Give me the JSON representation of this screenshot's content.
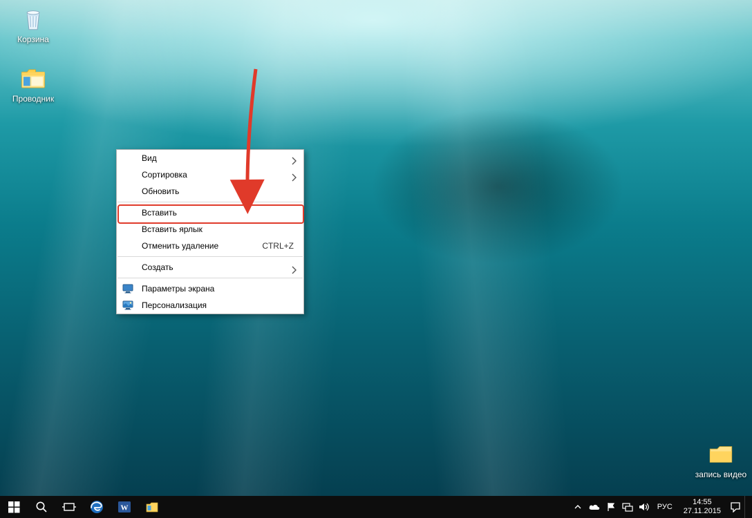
{
  "desktop": {
    "icons": {
      "recycle_bin": "Корзина",
      "file_explorer": "Проводник",
      "video_folder": "запись видео"
    }
  },
  "context_menu": {
    "view": "Вид",
    "sort": "Сортировка",
    "refresh": "Обновить",
    "paste": "Вставить",
    "paste_shortcut": "Вставить ярлык",
    "undo_delete": "Отменить удаление",
    "undo_shortcut": "CTRL+Z",
    "new": "Создать",
    "display_settings": "Параметры экрана",
    "personalize": "Персонализация"
  },
  "taskbar": {
    "lang": "РУС",
    "time": "14:55",
    "date": "27.11.2015"
  }
}
